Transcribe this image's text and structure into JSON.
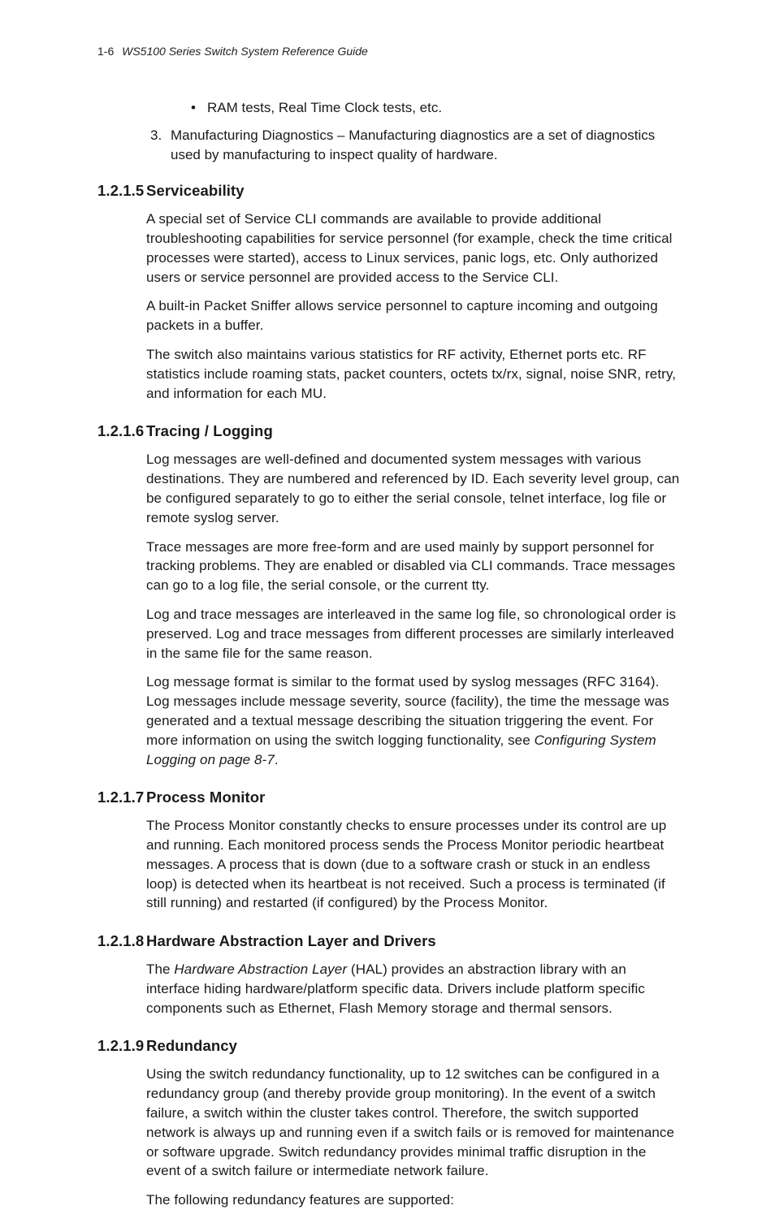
{
  "header": {
    "page_number": "1-6",
    "doc_title": "WS5100 Series Switch System Reference Guide"
  },
  "intro": {
    "bullet": "RAM tests, Real Time Clock tests, etc.",
    "num3_label": "3.",
    "num3_text": "Manufacturing Diagnostics – Manufacturing diagnostics are a set of diagnostics used by manufacturing to inspect quality of hardware."
  },
  "s5": {
    "num": "1.2.1.5",
    "title": "Serviceability",
    "p1": "A special set of Service CLI commands are available to provide additional troubleshooting capabilities for service personnel (for example, check the time critical processes were started), access to Linux services, panic logs, etc. Only authorized users or service personnel are provided access to the Service CLI.",
    "p2": "A built-in Packet Sniffer allows service personnel to capture incoming and outgoing packets in a buffer.",
    "p3": "The switch also maintains various statistics for RF activity, Ethernet ports etc. RF statistics include roaming stats, packet counters, octets tx/rx, signal, noise SNR, retry, and information for each MU."
  },
  "s6": {
    "num": "1.2.1.6",
    "title": "Tracing / Logging",
    "p1": "Log messages are well-defined and documented system messages with various destinations. They are numbered and referenced by ID. Each severity level group, can be configured separately to go to either the serial console, telnet interface, log file or remote syslog server.",
    "p2": "Trace messages are more free-form and are used mainly by support personnel for tracking problems. They are enabled or disabled via CLI commands. Trace messages can go to a log file, the serial console, or the current tty.",
    "p3": "Log and trace messages are interleaved in the same log file, so chronological order is preserved. Log and trace messages from different processes are similarly interleaved in the same file for the same reason.",
    "p4a": "Log message format is similar to the format used by syslog messages (RFC 3164). Log messages include message severity, source (facility), the time the message was generated and a textual message describing the situation triggering the event. For more information on using the switch logging functionality, see ",
    "p4b": "Configuring System Logging on page 8-7",
    "p4c": "."
  },
  "s7": {
    "num": "1.2.1.7",
    "title": "Process Monitor",
    "p1": "The Process Monitor constantly checks to ensure processes under its control are up and running. Each monitored process sends the Process Monitor periodic heartbeat messages. A process that is down (due to a software crash or stuck in an endless loop) is detected when its heartbeat is not received. Such a process is terminated (if still running) and restarted (if configured) by the Process Monitor."
  },
  "s8": {
    "num": "1.2.1.8",
    "title": "Hardware Abstraction Layer and Drivers",
    "p1a": "The ",
    "p1b": "Hardware Abstraction Layer",
    "p1c": " (HAL) provides an abstraction library with an interface hiding hardware/platform specific data. Drivers include platform specific components such as Ethernet, Flash Memory storage and thermal sensors."
  },
  "s9": {
    "num": "1.2.1.9",
    "title": "Redundancy",
    "p1": "Using the switch redundancy functionality, up to 12 switches can be configured in a redundancy group (and thereby provide group monitoring). In the event of a switch failure, a switch within the cluster takes control. Therefore, the switch supported network is always up and running even if a switch fails or is removed for maintenance or software upgrade. Switch redundancy provides minimal traffic disruption in the event of a switch failure or intermediate network failure.",
    "p2": "The following redundancy features are supported:"
  }
}
